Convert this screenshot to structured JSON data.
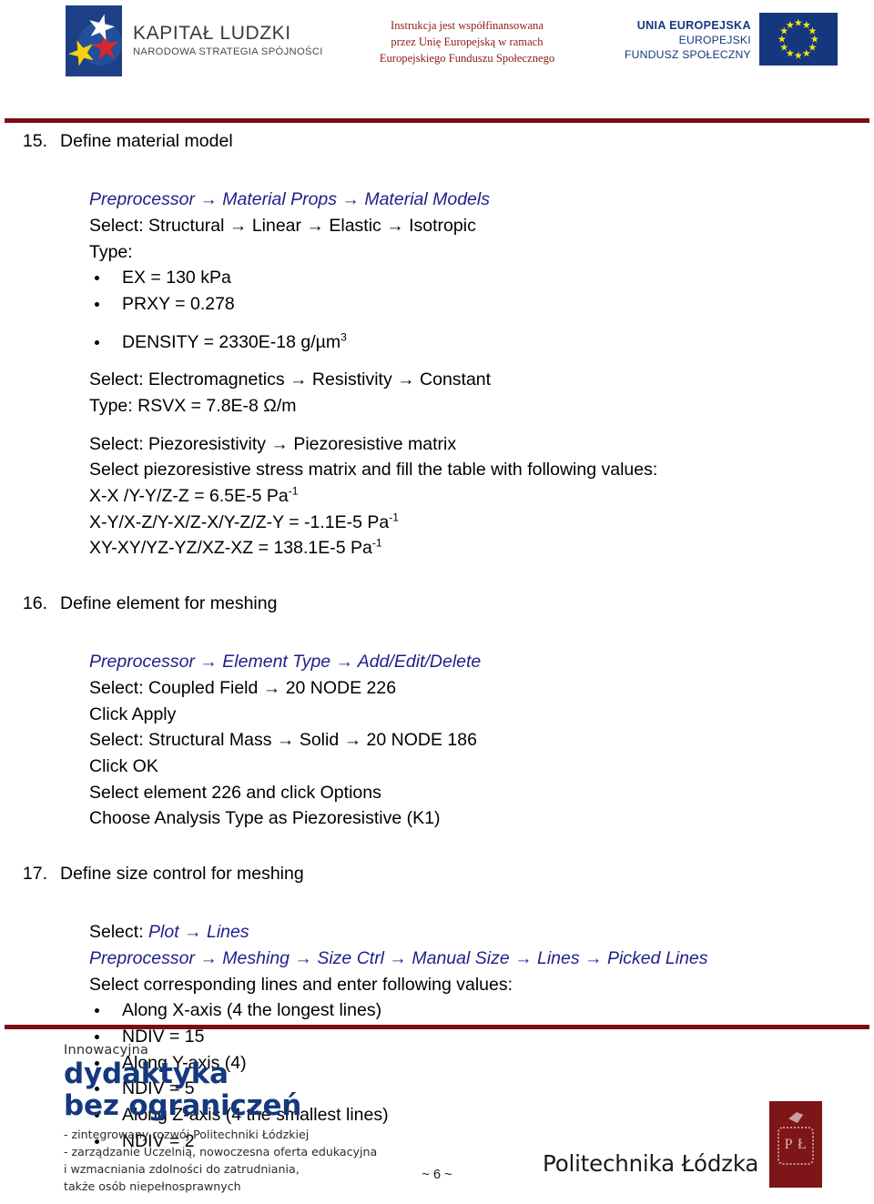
{
  "header": {
    "kapital_ludzki": {
      "title": "KAPITAŁ LUDZKI",
      "subtitle": "NARODOWA STRATEGIA SPÓJNOŚCI",
      "logo_icon": "kapital-ludzki-stars-icon"
    },
    "funding_note": {
      "line1": "Instrukcja jest współfinansowana",
      "line2": "przez Unię Europejską w ramach",
      "line3": "Europejskiego Funduszu Społecznego",
      "color": "#8d1a12"
    },
    "european_union": {
      "line1": "UNIA EUROPEJSKA",
      "line2": "EUROPEJSKI",
      "line3": "FUNDUSZ SPOŁECZNY",
      "flag_icon": "eu-flag-icon",
      "flag_color": "#15377e",
      "star_color": "#f5e41a"
    }
  },
  "rule_color": "#7b0e14",
  "steps": [
    {
      "number": "15.",
      "title": "Define material model",
      "menu_path_1": "Preprocessor → Material Props → Material Models",
      "select_1": "Select: Structural → Linear → Elastic → Isotropic",
      "type_label": "Type:",
      "bullets_1": [
        "EX = 130 kPa",
        "PRXY = 0.278"
      ],
      "density_pre": "DENSITY = 2330E-18 g/µm",
      "density_sup": "3",
      "select_2": "Select: Electromagnetics → Resistivity → Constant",
      "type_2": "Type: RSVX = 7.8E-8 Ω/m",
      "select_3": "Select: Piezoresistivity → Piezoresistive matrix",
      "select_4": "Select piezoresistive stress matrix and fill the table with following values:",
      "matrix_rows": [
        {
          "pre": "X-X /Y-Y/Z-Z = 6.5E-5 Pa",
          "sup": "-1"
        },
        {
          "pre": "X-Y/X-Z/Y-X/Z-X/Y-Z/Z-Y = -1.1E-5 Pa",
          "sup": "-1"
        },
        {
          "pre": "XY-XY/YZ-YZ/XZ-XZ = 138.1E-5 Pa",
          "sup": "-1"
        }
      ]
    },
    {
      "number": "16.",
      "title": "Define element for meshing",
      "menu_path_1": "Preprocessor → Element Type → Add/Edit/Delete",
      "lines": [
        "Select: Coupled Field → 20 NODE 226",
        "Click Apply",
        "Select: Structural Mass → Solid → 20 NODE 186",
        "Click OK",
        "Select element 226 and click Options",
        "Choose Analysis Type as Piezoresistive (K1)"
      ]
    },
    {
      "number": "17.",
      "title": "Define size control for meshing",
      "select_prefix": "Select: ",
      "menu_path_1": "Plot → Lines",
      "menu_path_2": "Preprocessor → Meshing → Size Ctrl → Manual Size → Lines → Picked Lines",
      "select_line": "Select corresponding lines and enter following values:",
      "bullets": [
        "Along X-axis (4 the longest lines)",
        "NDIV = 15",
        "Along Y-axis (4)",
        "NDIV = 5",
        "Along Z-axis (4 the smallest lines)",
        "NDIV = 2"
      ]
    }
  ],
  "footer": {
    "innowacyjna": "Innowacyjna",
    "dydaktyka_l1": "dydaktyka",
    "dydaktyka_l2": "bez ograniczeń",
    "desc": [
      "- zintegrowany rozwój Politechniki Łódzkiej",
      "- zarządzanie Uczelnią,  nowoczesna oferta edukacyjna",
      "i wzmacniania zdolności do zatrudniania,",
      "także osób niepełnosprawnych"
    ],
    "university": "Politechnika Łódzka",
    "crest_icon": "politechnika-lodzka-crest-icon",
    "crest_letters": "P Ł",
    "page_marker": "~ 6 ~",
    "brand_blue": "#15387e",
    "crest_red": "#7e1518"
  }
}
